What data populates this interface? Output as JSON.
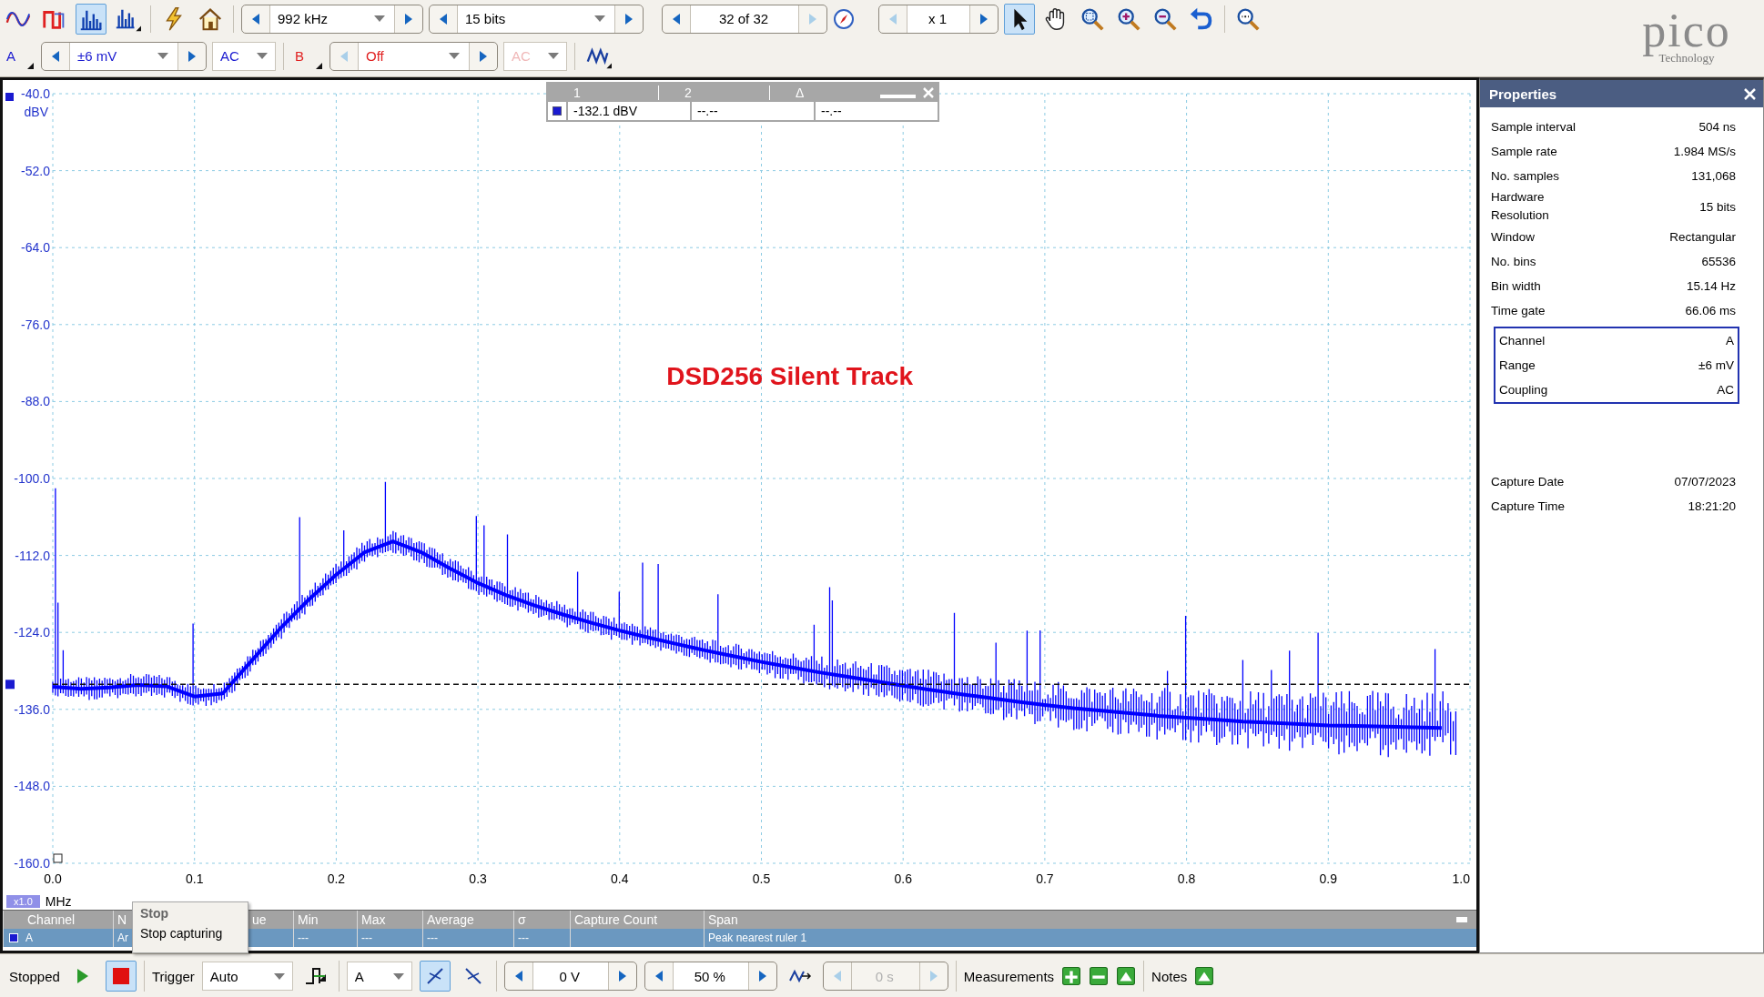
{
  "toolbar": {
    "view_buttons": [
      {
        "kind": "scope",
        "selected": false
      },
      {
        "kind": "persistence",
        "selected": false
      },
      {
        "kind": "spectrum",
        "selected": true
      },
      {
        "kind": "spectrum-options",
        "selected": false
      },
      {
        "kind": "auto-setup",
        "selected": false
      },
      {
        "kind": "home",
        "selected": false
      }
    ],
    "frequency": {
      "value": "992 kHz"
    },
    "resolution": {
      "value": "15 bits"
    },
    "buffer": {
      "value": "32 of 32"
    },
    "zoom": {
      "value": "x 1"
    },
    "tools": [
      {
        "kind": "pointer",
        "selected": true
      },
      {
        "kind": "hand",
        "selected": false
      },
      {
        "kind": "zoom-region",
        "selected": false
      },
      {
        "kind": "zoom-in",
        "selected": false
      },
      {
        "kind": "zoom-out",
        "selected": false
      },
      {
        "kind": "undo",
        "selected": false
      },
      {
        "kind": "zoom-100",
        "selected": false
      }
    ],
    "logo": {
      "name": "pico",
      "tagline": "Technology"
    }
  },
  "channels": [
    {
      "label": "A",
      "color": "#1a1ad0",
      "range": "±6 mV",
      "coupling": "AC",
      "enabled": true
    },
    {
      "label": "B",
      "color": "#e02020",
      "range": "Off",
      "coupling": "AC",
      "enabled": false
    }
  ],
  "plot": {
    "chart_data": {
      "type": "line",
      "xlabel": "MHz",
      "ylabel": "dBV",
      "xlim": [
        0,
        1
      ],
      "ylim": [
        -160,
        -40
      ],
      "xticks": [
        {
          "value": 0,
          "label": "0.0"
        },
        {
          "value": 0.1,
          "label": "0.1"
        },
        {
          "value": 0.2,
          "label": "0.2"
        },
        {
          "value": 0.3,
          "label": "0.3"
        },
        {
          "value": 0.4,
          "label": "0.4"
        },
        {
          "value": 0.5,
          "label": "0.5"
        },
        {
          "value": 0.6,
          "label": "0.6"
        },
        {
          "value": 0.7,
          "label": "0.7"
        },
        {
          "value": 0.8,
          "label": "0.8"
        },
        {
          "value": 0.9,
          "label": "0.9"
        },
        {
          "value": 1,
          "label": "1.0"
        }
      ],
      "yticks": [
        {
          "value": -40,
          "label": "-40.0"
        },
        {
          "value": -52,
          "label": "-52.0"
        },
        {
          "value": -64,
          "label": "-64.0"
        },
        {
          "value": -76,
          "label": "-76.0"
        },
        {
          "value": -88,
          "label": "-88.0"
        },
        {
          "value": -100,
          "label": "-100.0"
        },
        {
          "value": -112,
          "label": "-112.0"
        },
        {
          "value": -124,
          "label": "-124.0"
        },
        {
          "value": -136,
          "label": "-136.0"
        },
        {
          "value": -148,
          "label": "-148.0"
        },
        {
          "value": -160,
          "label": "-160.0"
        }
      ],
      "x": [
        0,
        0.02,
        0.04,
        0.06,
        0.08,
        0.1,
        0.12,
        0.14,
        0.16,
        0.18,
        0.2,
        0.22,
        0.24,
        0.26,
        0.28,
        0.3,
        0.32,
        0.34,
        0.36,
        0.38,
        0.4,
        0.42,
        0.44,
        0.46,
        0.48,
        0.5,
        0.52,
        0.54,
        0.56,
        0.58,
        0.6,
        0.62,
        0.64,
        0.66,
        0.68,
        0.7,
        0.72,
        0.74,
        0.76,
        0.78,
        0.8,
        0.82,
        0.84,
        0.86,
        0.88,
        0.9,
        0.92,
        0.94,
        0.96,
        0.98
      ],
      "series": [
        {
          "color": "#0000ff",
          "values": [
            -132.5,
            -132.8,
            -132.6,
            -132.2,
            -132.4,
            -134.0,
            -133.5,
            -128.5,
            -123.5,
            -119.0,
            -115.0,
            -111.5,
            -109.8,
            -111.5,
            -114.0,
            -116.3,
            -118.2,
            -119.8,
            -121.2,
            -122.5,
            -123.7,
            -124.8,
            -125.8,
            -126.8,
            -127.7,
            -128.6,
            -129.4,
            -130.2,
            -130.9,
            -131.6,
            -132.3,
            -133.0,
            -133.6,
            -134.2,
            -134.8,
            -135.3,
            -135.8,
            -136.2,
            -136.6,
            -137.0,
            -137.3,
            -137.6,
            -137.9,
            -138.1,
            -138.3,
            -138.5,
            -138.6,
            -138.7,
            -138.8,
            -138.9
          ]
        }
      ],
      "grid": true,
      "annotations": [
        "DSD256 Silent Track"
      ],
      "ref_lines": [
        {
          "axis": "y",
          "value": -132.1
        }
      ]
    },
    "x_scale": "x1.0",
    "ruler_table": {
      "columns": [
        "1",
        "2",
        "Δ"
      ],
      "values": [
        "-132.1 dBV",
        "--.--",
        "--.--"
      ]
    }
  },
  "measurements": {
    "columns": [
      "Channel",
      "N",
      "ue",
      "Min",
      "Max",
      "Average",
      "σ",
      "Capture Count",
      "Span"
    ],
    "rows": [
      {
        "cells": [
          "A",
          "Ar",
          null,
          "---",
          "---",
          "---",
          "---",
          null,
          "Peak nearest ruler 1"
        ]
      }
    ]
  },
  "tooltip": {
    "title": "Stop",
    "text": "Stop capturing"
  },
  "properties": {
    "title": "Properties",
    "items": [
      {
        "label": "Sample interval",
        "value": "504 ns"
      },
      {
        "label": "Sample rate",
        "value": "1.984 MS/s"
      },
      {
        "label": "No. samples",
        "value": "131,068"
      },
      {
        "label": "Hardware Resolution",
        "value": "15 bits"
      },
      {
        "label": "Window",
        "value": "Rectangular"
      },
      {
        "label": "No. bins",
        "value": "65536"
      },
      {
        "label": "Bin width",
        "value": "15.14 Hz"
      },
      {
        "label": "Time gate",
        "value": "66.06 ms"
      }
    ],
    "channel_group": [
      {
        "label": "Channel",
        "value": "A"
      },
      {
        "label": "Range",
        "value": "±6 mV"
      },
      {
        "label": "Coupling",
        "value": "AC"
      }
    ],
    "capture": [
      {
        "label": "Capture Date",
        "value": "07/07/2023"
      },
      {
        "label": "Capture Time",
        "value": "18:21:20"
      }
    ]
  },
  "status_bar": {
    "state": "Stopped",
    "capture_buttons": [
      {
        "kind": "run",
        "selected": false
      },
      {
        "kind": "stop",
        "selected": true
      }
    ],
    "trigger_label": "Trigger",
    "trigger_mode": "Auto",
    "trigger_source": "A",
    "edges": [
      {
        "kind": "rising",
        "selected": true
      },
      {
        "kind": "falling",
        "selected": false
      }
    ],
    "threshold": "0 V",
    "pretrigger": "50 %",
    "delay": {
      "value": "0 s",
      "disabled": true
    },
    "measurements_label": "Measurements",
    "measurement_buttons": [
      {
        "kind": "add"
      },
      {
        "kind": "remove"
      },
      {
        "kind": "edit"
      }
    ],
    "notes_label": "Notes"
  }
}
